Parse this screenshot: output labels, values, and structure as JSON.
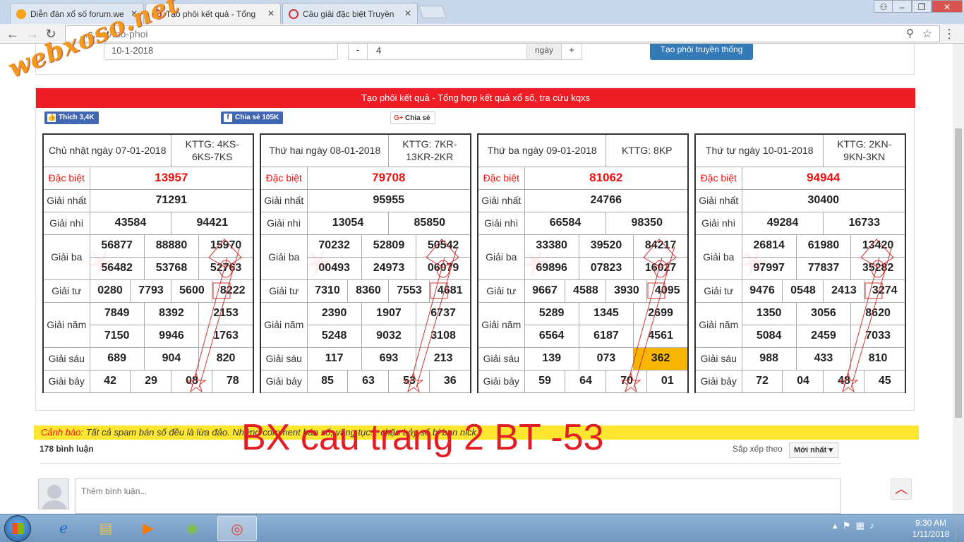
{
  "browser": {
    "tabs": [
      {
        "title": "Diễn đàn xổ số forum.we",
        "active": false
      },
      {
        "title": "Tạo phôi kết quả - Tổng",
        "active": true
      },
      {
        "title": "Cầu giải đặc biệt Truyền",
        "active": false
      }
    ],
    "url_host": "...s.net",
    "url_path": "/tao-phoi"
  },
  "logo_text": "webxoso.net",
  "search": {
    "date_value": "10-1-2018",
    "minus_label": "-",
    "days_value": "4",
    "days_unit": "ngày",
    "plus_label": "+",
    "generate_label": "Tạo phôi truyền thống"
  },
  "main": {
    "title": "Tạo phôi kết quả - Tổng hợp kết quả xổ số, tra cứu kqxs",
    "like_label": "Thích 3,4K",
    "share_fb_label": "Chia sẻ 105K",
    "share_gp_label": "Chia sẻ"
  },
  "labels": {
    "db": "Đặc biệt",
    "g1": "Giải nhất",
    "g2": "Giải nhì",
    "g3": "Giải ba",
    "g4": "Giải tư",
    "g5": "Giải năm",
    "g6": "Giải sáu",
    "g7": "Giải bảy"
  },
  "cards": [
    {
      "date": "Chủ nhật ngày 07-01-2018",
      "kttg": "KTTG: 4KS-6KS-7KS",
      "db": "13957",
      "g1": "71291",
      "g2": [
        "43584",
        "94421"
      ],
      "g3": [
        "56877",
        "88880",
        "15970",
        "56482",
        "53768",
        "52763"
      ],
      "g4": [
        "0280",
        "7793",
        "5600",
        "8222"
      ],
      "g5": [
        "7849",
        "8392",
        "2153",
        "7150",
        "9946",
        "1763"
      ],
      "g6": [
        "689",
        "904",
        "820"
      ],
      "g7": [
        "42",
        "29",
        "08",
        "78"
      ],
      "highlight_g6": -1
    },
    {
      "date": "Thứ hai ngày 08-01-2018",
      "kttg": "KTTG: 7KR-13KR-2KR",
      "db": "79708",
      "g1": "95955",
      "g2": [
        "13054",
        "85850"
      ],
      "g3": [
        "70232",
        "52809",
        "50542",
        "00493",
        "24973",
        "06079"
      ],
      "g4": [
        "7310",
        "8360",
        "7553",
        "4681"
      ],
      "g5": [
        "2390",
        "1907",
        "6737",
        "5248",
        "9032",
        "3108"
      ],
      "g6": [
        "117",
        "693",
        "213"
      ],
      "g7": [
        "85",
        "63",
        "53",
        "36"
      ],
      "highlight_g6": -1
    },
    {
      "date": "Thứ ba ngày 09-01-2018",
      "kttg": "KTTG: 8KP",
      "db": "81062",
      "g1": "24766",
      "g2": [
        "66584",
        "98350"
      ],
      "g3": [
        "33380",
        "39520",
        "84217",
        "69896",
        "07823",
        "16027"
      ],
      "g4": [
        "9667",
        "4588",
        "3930",
        "4095"
      ],
      "g5": [
        "5289",
        "1345",
        "2699",
        "6564",
        "6187",
        "4561"
      ],
      "g6": [
        "139",
        "073",
        "362"
      ],
      "g7": [
        "59",
        "64",
        "70",
        "01"
      ],
      "highlight_g6": 2
    },
    {
      "date": "Thứ tư ngày 10-01-2018",
      "kttg": "KTTG: 2KN-9KN-3KN",
      "db": "94944",
      "g1": "30400",
      "g2": [
        "49284",
        "16733"
      ],
      "g3": [
        "26814",
        "61980",
        "13420",
        "97997",
        "77837",
        "35282"
      ],
      "g4": [
        "9476",
        "0548",
        "2413",
        "3274"
      ],
      "g5": [
        "1350",
        "3056",
        "8620",
        "5084",
        "2459",
        "7033"
      ],
      "g6": [
        "988",
        "433",
        "810"
      ],
      "g7": [
        "72",
        "04",
        "48",
        "45"
      ],
      "highlight_g6": -1
    }
  ],
  "comments": {
    "warning_label": "Cảnh báo:",
    "warning_text": " Tất cả spam bán số đều là lừa đảo. Những comment bán số, vãng tục... chặn bảy số bị ban nick.",
    "overlay": "BX cau trang 2 BT -53",
    "count": "178 bình luận",
    "sort_label": "Sắp xếp theo",
    "sort_value": "Mới nhất ▾",
    "placeholder": "Thêm bình luận..."
  },
  "taskbar": {
    "time": "9:30 AM",
    "date": "1/11/2018"
  }
}
